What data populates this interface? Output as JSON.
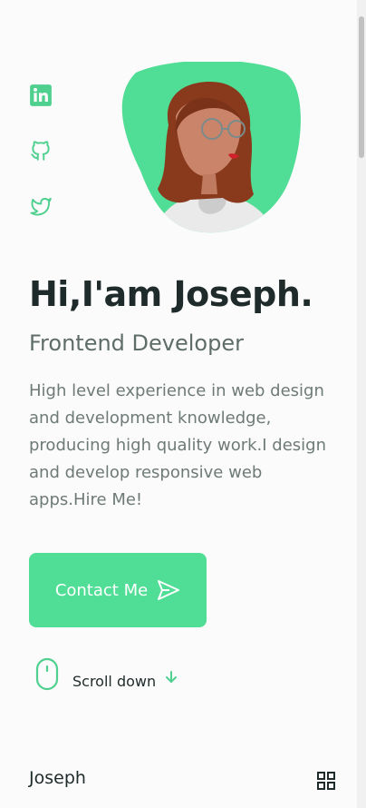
{
  "hero": {
    "title": "Hi,I'am Joseph.",
    "subtitle": "Frontend Developer",
    "description": "High level experience in web design and development knowledge, producing high quality work.I design and develop responsive web apps.Hire Me!"
  },
  "social": [
    {
      "icon": "linkedin-icon"
    },
    {
      "icon": "github-icon"
    },
    {
      "icon": "twitter-icon"
    }
  ],
  "contact": {
    "label": "Contact Me",
    "icon": "send-icon"
  },
  "scroll": {
    "label": "Scroll down",
    "icons": [
      "mouse-icon",
      "arrow-down-icon"
    ]
  },
  "nav": {
    "brand": "Joseph",
    "menu_icon": "grid-menu-icon"
  },
  "colors": {
    "accent": "#50dd95",
    "title": "#1f2a2a",
    "text": "#6e7a77",
    "background": "#fbfbfb"
  }
}
